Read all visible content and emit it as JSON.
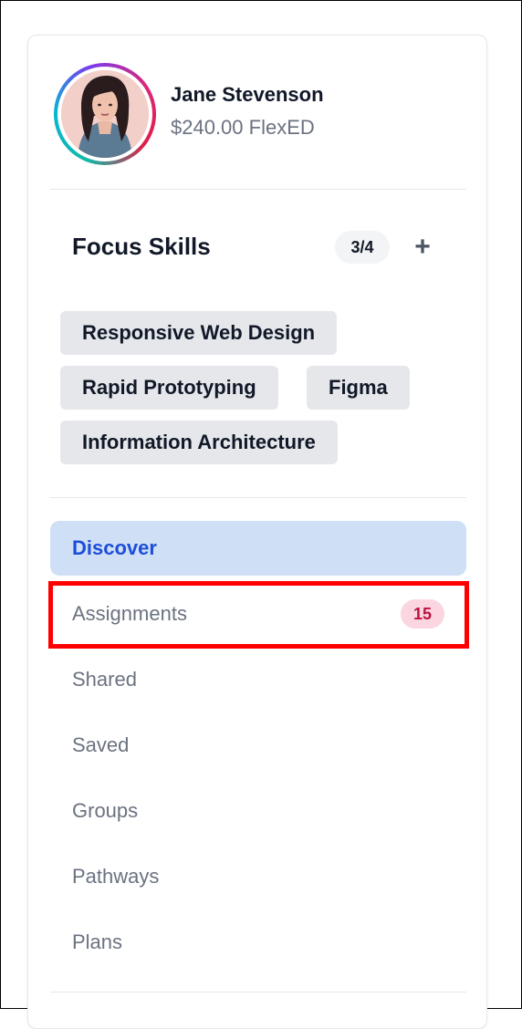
{
  "profile": {
    "name": "Jane Stevenson",
    "balance": "$240.00 FlexED"
  },
  "focus_skills": {
    "title": "Focus Skills",
    "count": "3/4",
    "add_label": "+",
    "chips": [
      "Responsive Web Design",
      "Rapid Prototyping",
      "Figma",
      "Information Architecture"
    ]
  },
  "nav": {
    "items": [
      {
        "label": "Discover",
        "active": true
      },
      {
        "label": "Assignments",
        "badge": "15"
      },
      {
        "label": "Shared"
      },
      {
        "label": "Saved"
      },
      {
        "label": "Groups"
      },
      {
        "label": "Pathways"
      },
      {
        "label": "Plans"
      }
    ]
  },
  "colors": {
    "active_bg": "#cfe0f6",
    "active_text": "#1d4ed8",
    "badge_bg": "#fbd5e0",
    "badge_text": "#be123c",
    "highlight": "#ff0000"
  }
}
